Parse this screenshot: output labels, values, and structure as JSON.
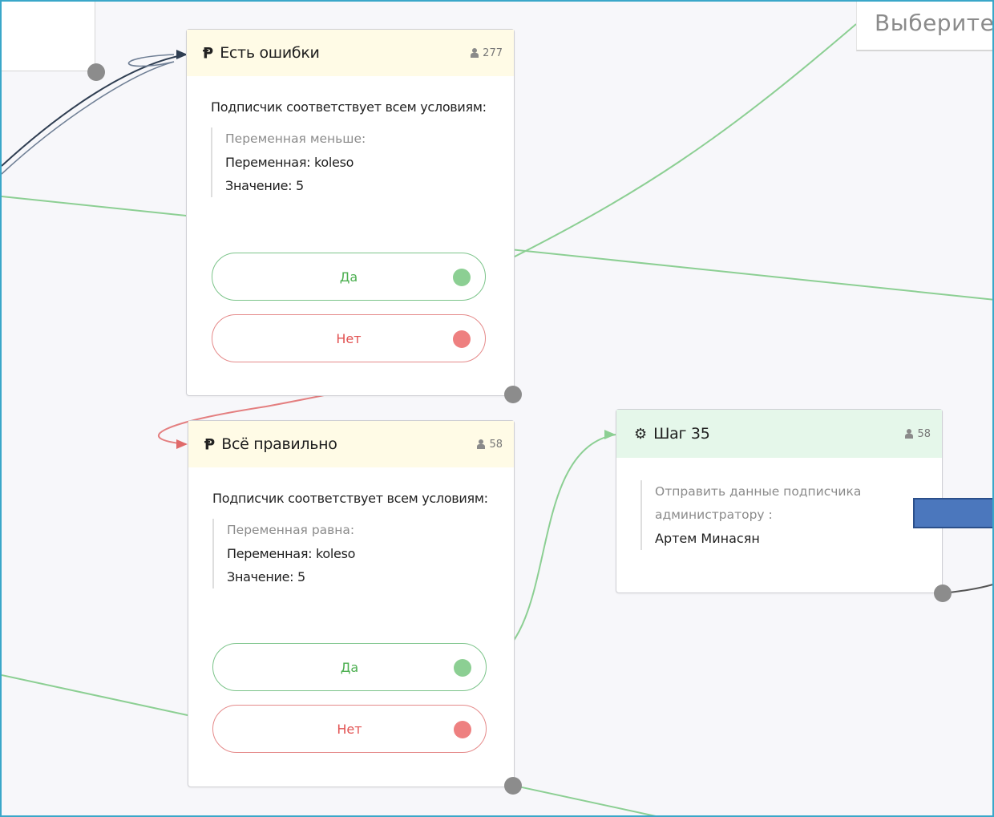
{
  "search": {
    "placeholder": "Выберите"
  },
  "nodes": {
    "errors": {
      "title": "Есть ошибки",
      "count": "277",
      "description": "Подписчик соответствует всем условиям:",
      "condition_type": "Переменная меньше:",
      "variable": "Переменная: koleso",
      "value": "Значение: 5",
      "yes_label": "Да",
      "no_label": "Нет"
    },
    "correct": {
      "title": "Всё правильно",
      "count": "58",
      "description": "Подписчик соответствует всем условиям:",
      "condition_type": "Переменная равна:",
      "variable": "Переменная: koleso",
      "value": "Значение: 5",
      "yes_label": "Да",
      "no_label": "Нет"
    },
    "step35": {
      "title": "Шаг 35",
      "count": "58",
      "action_type": "Отправить данные подписчика администратору :",
      "recipient": "Артем Минасян"
    }
  },
  "colors": {
    "canvas_border": "#3aa7c9",
    "yes_green": "#4caf50",
    "no_red": "#e25252",
    "condition_header": "#fffbe6",
    "action_header": "#e5f7ea",
    "edge_green": "#8ccf93",
    "edge_red": "#e06a6a",
    "edge_dark": "#2f3e52",
    "blue_rect": "#4b77bd"
  },
  "icons": {
    "condition": "branch-icon",
    "action": "gears-icon",
    "counter": "user-icon"
  }
}
